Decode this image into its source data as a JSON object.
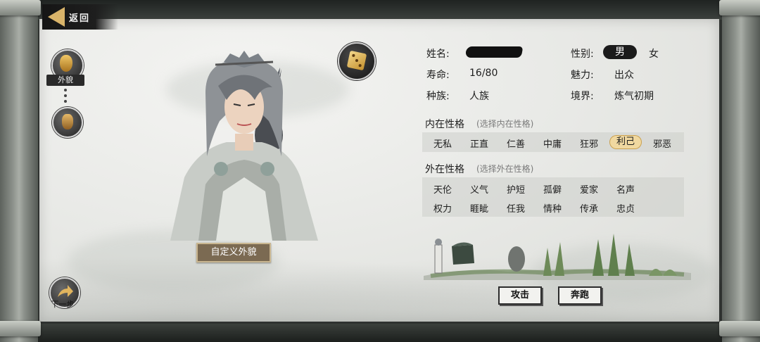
{
  "header": {
    "back_label": "返回"
  },
  "sidebar": {
    "appearance_label": "外貌",
    "next_label": "下一步"
  },
  "portrait": {
    "custom_button": "自定义外貌"
  },
  "profile": {
    "name_label": "姓名:",
    "gender_label": "性别:",
    "gender_male": "男",
    "gender_female": "女",
    "lifespan_label": "寿命:",
    "lifespan_value": "16/80",
    "charm_label": "魅力:",
    "charm_value": "出众",
    "race_label": "种族:",
    "race_value": "人族",
    "realm_label": "境界:",
    "realm_value": "炼气初期"
  },
  "inner_traits": {
    "title": "内在性格",
    "hint": "(选择内在性格)",
    "options": [
      "无私",
      "正直",
      "仁善",
      "中庸",
      "狂邪",
      "利己",
      "邪恶"
    ],
    "selected": "利己"
  },
  "outer_traits": {
    "title": "外在性格",
    "hint": "(选择外在性格)",
    "row1": [
      "天伦",
      "义气",
      "护短",
      "孤僻",
      "爱家",
      "名声"
    ],
    "row2": [
      "权力",
      "睚眦",
      "任我",
      "情种",
      "传承",
      "忠贞"
    ]
  },
  "actions": {
    "attack": "攻击",
    "flee": "奔跑"
  },
  "colors": {
    "selected_trait": "#f0d8a0",
    "custom_button": "#7b6a52",
    "back_arrow": "#d9b46a"
  }
}
